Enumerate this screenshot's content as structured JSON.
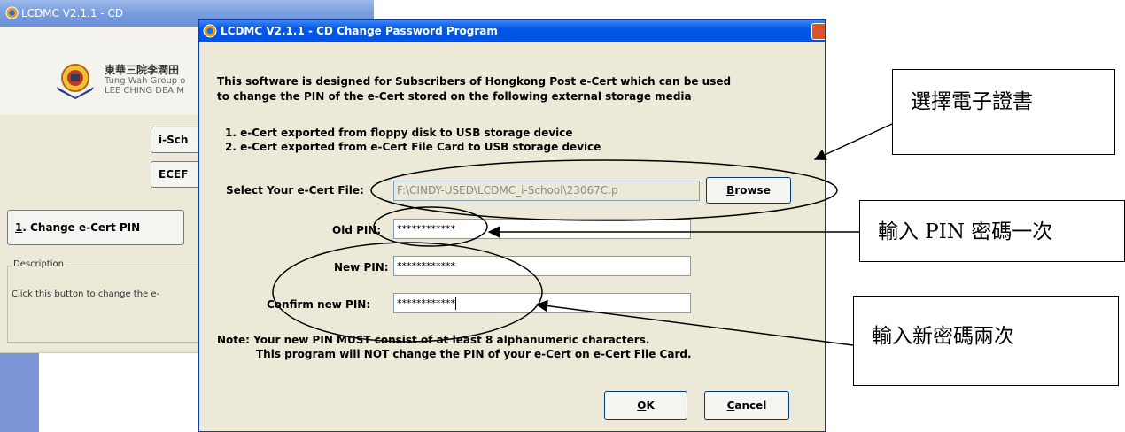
{
  "background_window": {
    "title": "LCDMC V2.1.1 - CD",
    "logo_chinese": "東華三院李潤田",
    "logo_english_1": "Tung Wah Group o",
    "logo_english_2": "LEE CHING DEA M",
    "ischool_button": "i-Sch",
    "ecef_button": "ECEF",
    "change_pin_button_num": "1",
    "change_pin_button_rest": ". Change e-Cert PIN",
    "description_legend": "Description",
    "description_text": "Click this button to change the e-"
  },
  "dialog": {
    "title": "LCDMC V2.1.1 - CD Change Password Program",
    "intro_line1": "This software is designed for Subscribers of Hongkong Post e-Cert which can be used",
    "intro_line2": "to change the PIN of the e-Cert stored on the following external storage media",
    "list_item1": "1. e-Cert exported from floppy disk to USB storage device",
    "list_item2": "2. e-Cert exported from e-Cert File Card to USB storage device",
    "select_label": "Select Your e-Cert File:",
    "file_path": "F:\\CINDY-USED\\LCDMC_i-School\\23067C.p",
    "browse_mnemonic": "B",
    "browse_rest": "rowse",
    "old_pin_label": "Old PIN:",
    "old_pin_value": "************",
    "new_pin_label": "New PIN:",
    "new_pin_value": "************",
    "confirm_pin_label": "Confirm new PIN:",
    "confirm_pin_value": "************",
    "note_line1": "Note:  Your new PIN MUST consist of at least 8 alphanumeric characters.",
    "note_line2": "This program will NOT change the PIN of your e-Cert on e-Cert File Card.",
    "ok_mnemonic": "O",
    "ok_rest": "K",
    "cancel_mnemonic": "C",
    "cancel_rest": "ancel"
  },
  "annotations": {
    "select_cert": "選擇電子證書",
    "enter_pin_once": "輸入 PIN 密碼一次",
    "enter_new_twice": "輸入新密碼兩次"
  },
  "colors": {
    "dialog_title_blue": "#0054e3",
    "window_face": "#ece9d8",
    "bg_title_blue": "#7a9fe0"
  }
}
